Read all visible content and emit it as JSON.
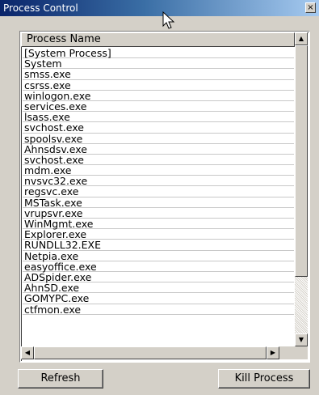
{
  "window": {
    "title": "Process Control",
    "close_glyph": "×"
  },
  "list": {
    "column_header": "Process Name",
    "rows": [
      "[System Process]",
      "System",
      "smss.exe",
      "csrss.exe",
      "winlogon.exe",
      "services.exe",
      "lsass.exe",
      "svchost.exe",
      "spoolsv.exe",
      "Ahnsdsv.exe",
      "svchost.exe",
      "mdm.exe",
      "nvsvc32.exe",
      "regsvc.exe",
      "MSTask.exe",
      "vrupsvr.exe",
      "WinMgmt.exe",
      "Explorer.exe",
      "RUNDLL32.EXE",
      "Netpia.exe",
      "easyoffice.exe",
      "ADSpider.exe",
      "AhnSD.exe",
      "GOMYPC.exe",
      "ctfmon.exe"
    ]
  },
  "scrollbar": {
    "up_glyph": "▲",
    "down_glyph": "▼",
    "left_glyph": "◀",
    "right_glyph": "▶"
  },
  "buttons": {
    "refresh": "Refresh",
    "kill": "Kill Process"
  }
}
